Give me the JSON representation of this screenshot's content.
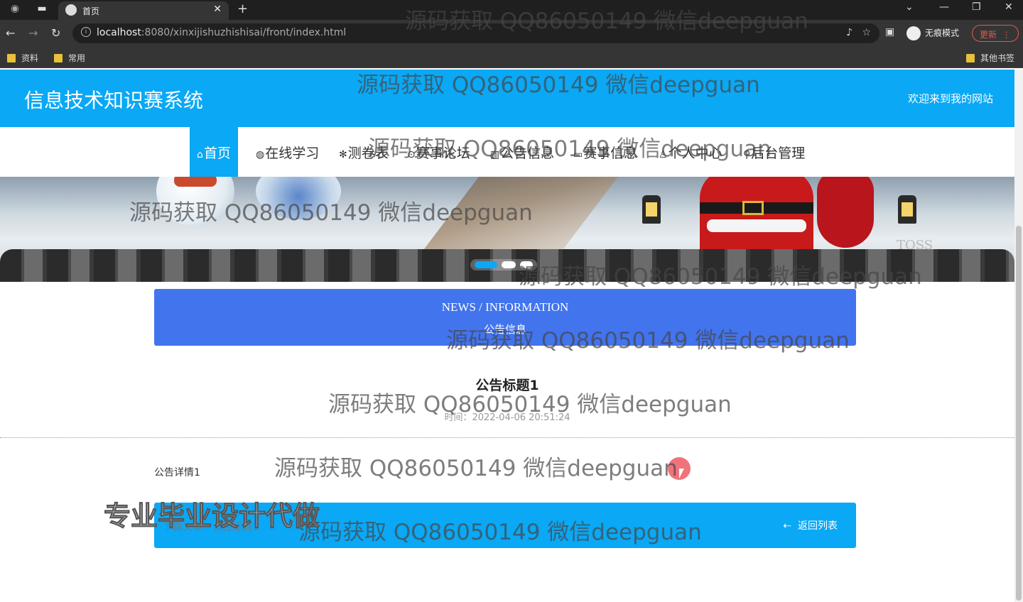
{
  "browser": {
    "tab_title": "首页",
    "url_host": "localhost",
    "url_rest": ":8080/xinxijishuzhishisai/front/index.html",
    "incognito_label": "无痕模式",
    "update_label": "更新",
    "bookmarks": [
      "资料",
      "常用"
    ],
    "other_bookmarks": "其他书签"
  },
  "header": {
    "site_title": "信息技术知识赛系统",
    "welcome": "欢迎来到我的网站",
    "bg_color": "#0aa8f5"
  },
  "nav": {
    "items": [
      {
        "icon": "⌂",
        "label": "首页"
      },
      {
        "icon": "◍",
        "label": "在线学习"
      },
      {
        "icon": "✻",
        "label": "测卷表"
      },
      {
        "icon": "⊙",
        "label": "赛事论坛"
      },
      {
        "icon": "▥",
        "label": "公告信息"
      },
      {
        "icon": "▭",
        "label": "赛事信息"
      },
      {
        "icon": "♙",
        "label": "个人中心"
      },
      {
        "icon": "⚲",
        "label": "后台管理"
      }
    ]
  },
  "banner": {
    "stone_text": "TOSS"
  },
  "news": {
    "title_en": "NEWS / INFORMATION",
    "title_cn": "公告信息",
    "bg_color": "#4274ee"
  },
  "article": {
    "title": "公告标题1",
    "time": "时间：2022-04-06 20:51:24",
    "body": "公告详情1",
    "next_label": "下篇文章：公告标题1",
    "back_label": "返回列表"
  },
  "watermarks": {
    "text": "源码获取 QQ86050149 微信deepguan",
    "big": "专业毕业设计代做"
  }
}
